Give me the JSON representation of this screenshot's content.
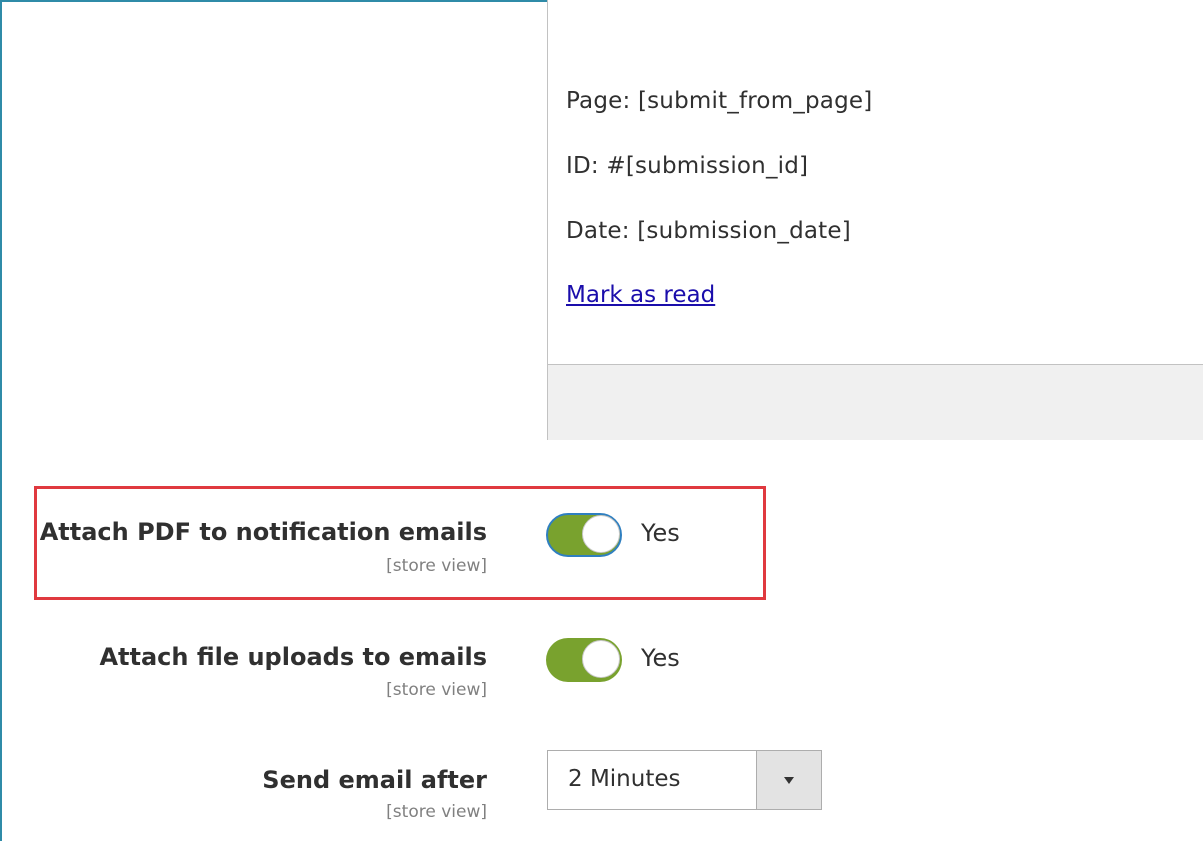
{
  "preview": {
    "page_line": "Page: [submit_from_page]",
    "id_line": "ID: #[submission_id]",
    "date_line": "Date: [submission_date]",
    "mark_read_link": "Mark as read"
  },
  "fields": {
    "attach_pdf": {
      "label": "Attach PDF to notification emails",
      "scope": "[store view]",
      "value": "Yes",
      "enabled": true,
      "highlighted": true
    },
    "attach_uploads": {
      "label": "Attach file uploads to emails",
      "scope": "[store view]",
      "value": "Yes",
      "enabled": true
    },
    "send_after": {
      "label": "Send email after",
      "scope": "[store view]",
      "selected": "2 Minutes",
      "icon": "chevron-down-icon"
    }
  },
  "colors": {
    "toggle_on": "#79a22e",
    "highlight_border": "#e0393f",
    "link": "#1a0dab",
    "frame_accent": "#2f8ba8"
  }
}
